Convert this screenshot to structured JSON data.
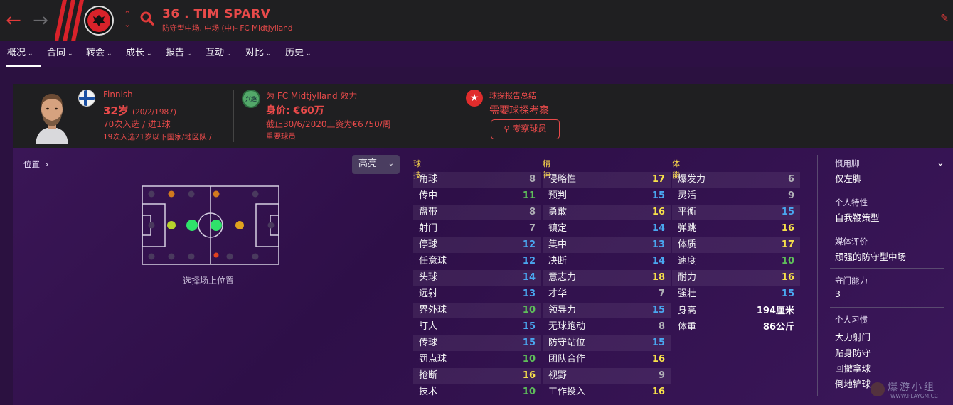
{
  "header": {
    "player_title": "36 . TIM SPARV",
    "player_subtitle": "防守型中场, 中场 (中)- FC Midtjylland",
    "back_icon": "arrow-left-icon",
    "forward_icon": "arrow-right-icon"
  },
  "tabs": [
    {
      "label": "概况"
    },
    {
      "label": "合同"
    },
    {
      "label": "转会"
    },
    {
      "label": "成长"
    },
    {
      "label": "报告"
    },
    {
      "label": "互动"
    },
    {
      "label": "对比"
    },
    {
      "label": "历史"
    }
  ],
  "summary": {
    "nationality": "Finnish",
    "age": "32岁",
    "dob": "(20/2/1987)",
    "caps": "70次入选 / 进1球",
    "youth_caps": "19次入选21岁以下国家/地区队 /",
    "interest_badge": "兴趣",
    "club_line": "为 FC Midtjylland 效力",
    "value": "身价: €60万",
    "contract": "截止30/6/2020工资为€6750/周",
    "squad_status": "重要球员",
    "scout_heading": "球探报告总结",
    "scout_need": "需要球探考察",
    "scout_button": "考察球员"
  },
  "position_panel": {
    "link": "位置",
    "highlight": "高亮",
    "caption": "选择场上位置"
  },
  "attributes": {
    "technical": {
      "heading": "球技",
      "rows": [
        {
          "name": "角球",
          "value": "8"
        },
        {
          "name": "传中",
          "value": "11"
        },
        {
          "name": "盘带",
          "value": "8"
        },
        {
          "name": "射门",
          "value": "7"
        },
        {
          "name": "停球",
          "value": "12"
        },
        {
          "name": "任意球",
          "value": "12"
        },
        {
          "name": "头球",
          "value": "14"
        },
        {
          "name": "远射",
          "value": "13"
        },
        {
          "name": "界外球",
          "value": "10"
        },
        {
          "name": "盯人",
          "value": "15"
        },
        {
          "name": "传球",
          "value": "15"
        },
        {
          "name": "罚点球",
          "value": "10"
        },
        {
          "name": "抢断",
          "value": "16"
        },
        {
          "name": "技术",
          "value": "10"
        }
      ]
    },
    "mental": {
      "heading": "精神",
      "rows": [
        {
          "name": "侵略性",
          "value": "17"
        },
        {
          "name": "预判",
          "value": "15"
        },
        {
          "name": "勇敢",
          "value": "16"
        },
        {
          "name": "镇定",
          "value": "14"
        },
        {
          "name": "集中",
          "value": "13"
        },
        {
          "name": "决断",
          "value": "14"
        },
        {
          "name": "意志力",
          "value": "18"
        },
        {
          "name": "才华",
          "value": "7"
        },
        {
          "name": "领导力",
          "value": "15"
        },
        {
          "name": "无球跑动",
          "value": "8"
        },
        {
          "name": "防守站位",
          "value": "15"
        },
        {
          "name": "团队合作",
          "value": "16"
        },
        {
          "name": "视野",
          "value": "9"
        },
        {
          "name": "工作投入",
          "value": "16"
        }
      ]
    },
    "physical": {
      "heading": "体能",
      "rows": [
        {
          "name": "爆发力",
          "value": "6"
        },
        {
          "name": "灵活",
          "value": "9"
        },
        {
          "name": "平衡",
          "value": "15"
        },
        {
          "name": "弹跳",
          "value": "16"
        },
        {
          "name": "体质",
          "value": "17"
        },
        {
          "name": "速度",
          "value": "10"
        },
        {
          "name": "耐力",
          "value": "16"
        },
        {
          "name": "强壮",
          "value": "15"
        }
      ],
      "height_label": "身高",
      "height_value": "194厘米",
      "weight_label": "体重",
      "weight_value": "86公斤"
    }
  },
  "profile": {
    "foot_label": "惯用脚",
    "foot_value": "仅左脚",
    "trait_label": "个人特性",
    "trait_value": "自我鞭策型",
    "media_label": "媒体评价",
    "media_value": "顽强的防守型中场",
    "gk_label": "守门能力",
    "gk_value": "3",
    "habits_label": "个人习惯",
    "habits": [
      "大力射门",
      "贴身防守",
      "回撤拿球",
      "倒地铲球"
    ]
  },
  "watermark": {
    "text": "爆游小组",
    "url": "WWW.PLAYGM.CC"
  },
  "colors": {
    "accent_red": "#e84a4a",
    "header_bg": "#1f1f21",
    "tab_bg": "#2d1044",
    "value_gray": "#b0b0b6",
    "value_green": "#5fbf5a",
    "value_blue": "#4aa7f0",
    "value_yellow": "#f7e04a"
  }
}
